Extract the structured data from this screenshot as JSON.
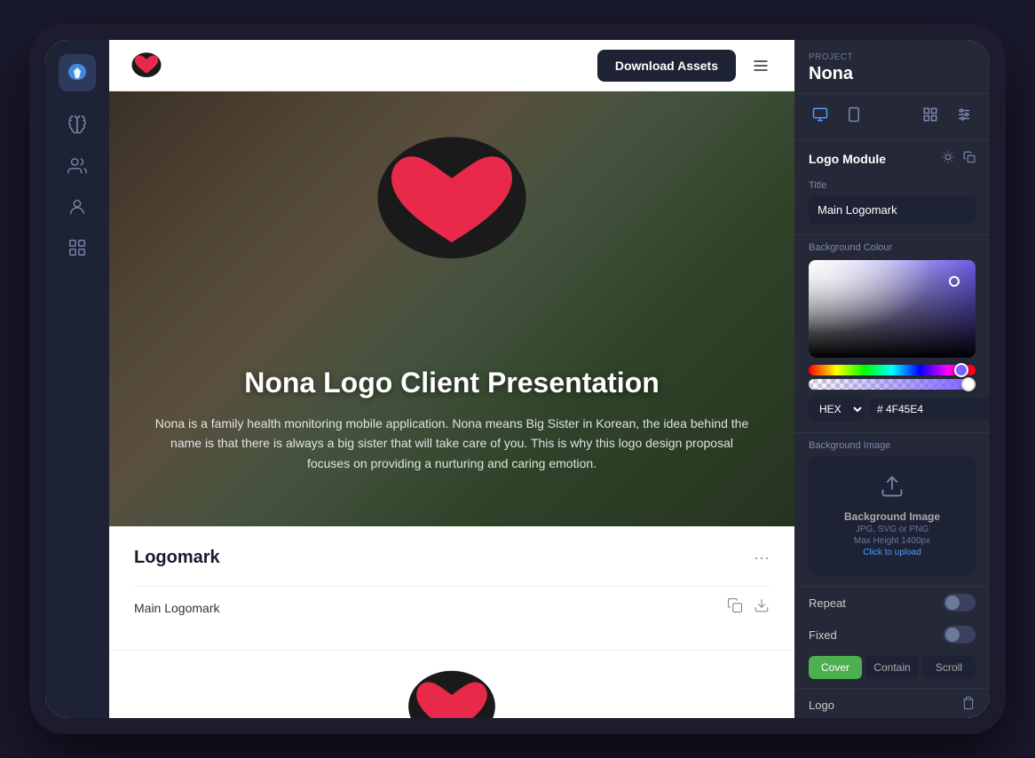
{
  "app": {
    "title": "Nona Logo Client Presentation"
  },
  "project": {
    "label": "Project",
    "name": "Nona"
  },
  "topbar": {
    "download_button": "Download Assets",
    "logo_alt": "Nona Logo"
  },
  "panel": {
    "module_title": "Logo Module",
    "title_label": "Title",
    "title_value": "Main Logomark",
    "bg_colour_label": "Background Colour",
    "hex_label": "HEX",
    "hex_value": "# 4F45E4",
    "opacity_value": "100%",
    "bg_image_label": "Background Image",
    "upload_text": "Background Image",
    "upload_formats": "JPG, SVG or PNG",
    "upload_max": "Max Height 1400px",
    "upload_link": "Click to upload",
    "repeat_label": "Repeat",
    "fixed_label": "Fixed",
    "cover_label": "Cover",
    "contain_label": "Contain",
    "scroll_label": "Scroll",
    "logo_label": "Logo"
  },
  "hero": {
    "title": "Nona Logo Client Presentation",
    "subtitle": "Nona is a family health monitoring mobile application. Nona means Big Sister in Korean, the idea behind the name is that there is always a big sister that will take care of you. This is why this logo design proposal focuses on providing a nurturing and caring emotion."
  },
  "content": {
    "logomark_title": "Logomark",
    "main_logomark": "Main Logomark"
  },
  "sidebar": {
    "items": [
      {
        "name": "brain-icon",
        "symbol": "❄"
      },
      {
        "name": "users-icon",
        "symbol": "⛁"
      },
      {
        "name": "user-icon",
        "symbol": "◯"
      },
      {
        "name": "apps-icon",
        "symbol": "⊞"
      }
    ]
  }
}
